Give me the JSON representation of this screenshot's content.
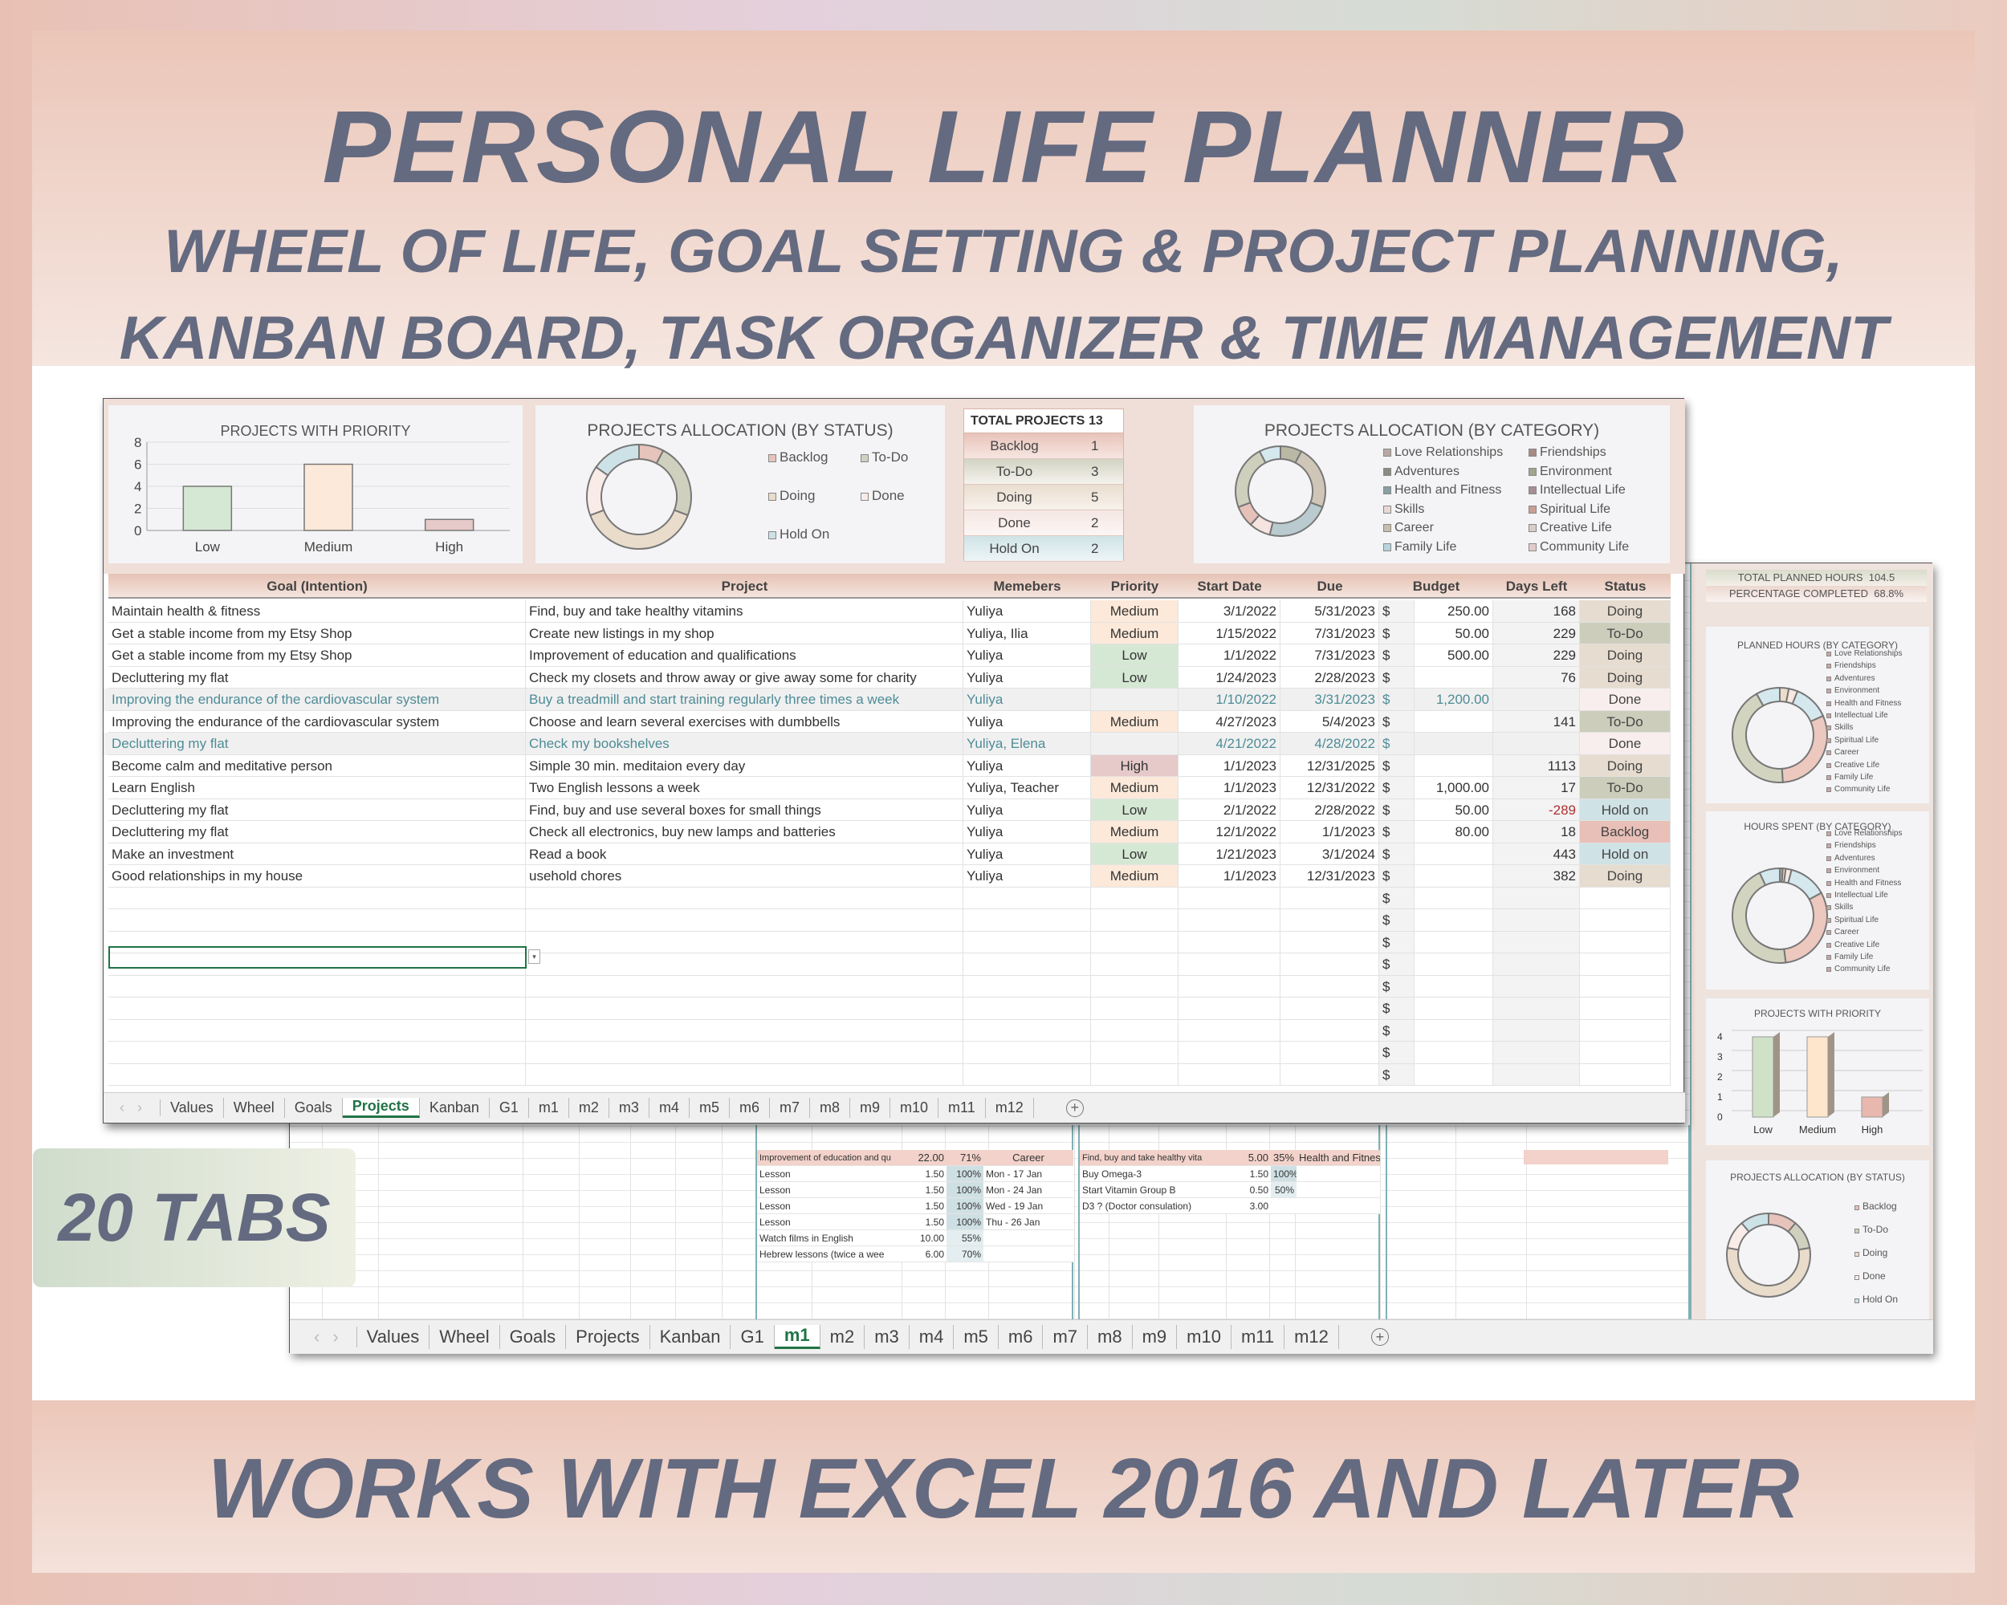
{
  "banner": {
    "title": "PERSONAL LIFE PLANNER",
    "subtitle1": "WHEEL OF LIFE, GOAL SETTING & PROJECT PLANNING,",
    "subtitle2": "KANBAN BOARD, TASK ORGANIZER & TIME MANAGEMENT",
    "footer": "WORKS WITH EXCEL 2016 AND LATER",
    "badge": "20 TABS"
  },
  "colors": {
    "text": "#646a80",
    "accent": "#217346",
    "Backlog": "#e8c0b8",
    "To-Do": "#cccdbb",
    "Doing": "#e6dccf",
    "Done": "#f9eeee",
    "Hold on": "#cfe2e6",
    "Low": "#d5e8d4",
    "Medium": "#fde9d9",
    "High": "#e6c9c9",
    "done_text": "#4e8c97",
    "negative": "#b03030"
  },
  "dashboard": {
    "priority_chart": {
      "title": "PROJECTS WITH PRIORITY",
      "type": "bar",
      "categories": [
        "Low",
        "Medium",
        "High"
      ],
      "values": [
        4,
        6,
        1
      ],
      "yticks": [
        "0",
        "2",
        "4",
        "6",
        "8"
      ],
      "ylim": [
        0,
        8
      ],
      "grid": true
    },
    "status_chart": {
      "title": "PROJECTS ALLOCATION (BY STATUS)",
      "type": "donut",
      "labels": [
        "Backlog",
        "To-Do",
        "Doing",
        "Done",
        "Hold On"
      ],
      "values": [
        1,
        3,
        5,
        2,
        2
      ],
      "colors": [
        "#e6c3bb",
        "#cfd0be",
        "#e9dccb",
        "#f9ece8",
        "#cde2e6"
      ]
    },
    "totals": {
      "label": "TOTAL PROJECTS",
      "value": "13",
      "rows": [
        {
          "label": "Backlog",
          "value": "1"
        },
        {
          "label": "To-Do",
          "value": "3"
        },
        {
          "label": "Doing",
          "value": "5"
        },
        {
          "label": "Done",
          "value": "2"
        },
        {
          "label": "Hold On",
          "value": "2"
        }
      ]
    },
    "category_chart": {
      "title": "PROJECTS ALLOCATION (BY CATEGORY)",
      "type": "donut",
      "legend": [
        "Love Relationships",
        "Friendships",
        "Adventures",
        "Environment",
        "Health and Fitness",
        "Intellectual Life",
        "Skills",
        "Spiritual Life",
        "Career",
        "Creative Life",
        "Family Life",
        "Community Life"
      ],
      "segments": [
        {
          "label": "Environment",
          "value": 1,
          "color": "#b8b8a4"
        },
        {
          "label": "Love Relationships",
          "value": 3,
          "color": "#cfc6b8"
        },
        {
          "label": "Health and Fitness",
          "value": 3,
          "color": "#b9cbce"
        },
        {
          "label": "Skills",
          "value": 1,
          "color": "#f6e4e0"
        },
        {
          "label": "Spiritual Life",
          "value": 1,
          "color": "#e6c1b8"
        },
        {
          "label": "Career",
          "value": 3,
          "color": "#cfcfbd"
        },
        {
          "label": "Family Life",
          "value": 1,
          "color": "#d4e8ee"
        }
      ]
    }
  },
  "table": {
    "headers": [
      "Goal (Intention)",
      "Project",
      "Memebers",
      "Priority",
      "Start Date",
      "Due",
      "Budget",
      "Days Left",
      "Status"
    ],
    "currency": "$",
    "rows": [
      {
        "goal": "Maintain health & fitness",
        "project": "Find, buy and take healthy vitamins",
        "members": "Yuliya",
        "priority": "Medium",
        "start": "3/1/2022",
        "due": "5/31/2023",
        "budget": "250.00",
        "days": "168",
        "status": "Doing"
      },
      {
        "goal": "Get a stable income from my Etsy Shop",
        "project": "Create new listings in my shop",
        "members": "Yuliya, Ilia",
        "priority": "Medium",
        "start": "1/15/2022",
        "due": "7/31/2023",
        "budget": "50.00",
        "days": "229",
        "status": "To-Do"
      },
      {
        "goal": "Get a stable income from my Etsy Shop",
        "project": "Improvement of education and qualifications",
        "members": "Yuliya",
        "priority": "Low",
        "start": "1/1/2022",
        "due": "7/31/2023",
        "budget": "500.00",
        "days": "229",
        "status": "Doing"
      },
      {
        "goal": "Decluttering my flat",
        "project": "Check my closets and throw away or give away some for charity",
        "members": "Yuliya",
        "priority": "Low",
        "start": "1/24/2023",
        "due": "2/28/2023",
        "budget": "",
        "days": "76",
        "status": "Doing"
      },
      {
        "goal": "Improving the endurance of the cardiovascular system",
        "project": "Buy a treadmill and start training regularly three times a week",
        "members": "Yuliya",
        "priority": "",
        "start": "1/10/2022",
        "due": "3/31/2023",
        "budget": "1,200.00",
        "days": "",
        "status": "Done"
      },
      {
        "goal": "Improving the endurance of the cardiovascular system",
        "project": "Choose and learn several exercises with dumbbells",
        "members": "Yuliya",
        "priority": "Medium",
        "start": "4/27/2023",
        "due": "5/4/2023",
        "budget": "",
        "days": "141",
        "status": "To-Do"
      },
      {
        "goal": "Decluttering my flat",
        "project": "Check my bookshelves",
        "members": "Yuliya, Elena",
        "priority": "",
        "start": "4/21/2022",
        "due": "4/28/2022",
        "budget": "",
        "days": "",
        "status": "Done"
      },
      {
        "goal": "Become calm and meditative person",
        "project": "Simple 30 min. meditaion every day",
        "members": "Yuliya",
        "priority": "High",
        "start": "1/1/2023",
        "due": "12/31/2025",
        "budget": "",
        "days": "1113",
        "status": "Doing"
      },
      {
        "goal": "Learn English",
        "project": "Two English lessons a week",
        "members": "Yuliya, Teacher",
        "priority": "Medium",
        "start": "1/1/2023",
        "due": "12/31/2022",
        "budget": "1,000.00",
        "days": "17",
        "status": "To-Do"
      },
      {
        "goal": "Decluttering my flat",
        "project": "Find, buy and use several boxes for small things",
        "members": "Yuliya",
        "priority": "Low",
        "start": "2/1/2022",
        "due": "2/28/2022",
        "budget": "50.00",
        "days": "-289",
        "status": "Hold on"
      },
      {
        "goal": "Decluttering my flat",
        "project": "Check all electronics, buy new lamps and batteries",
        "members": "Yuliya",
        "priority": "Medium",
        "start": "12/1/2022",
        "due": "1/1/2023",
        "budget": "80.00",
        "days": "18",
        "status": "Backlog"
      },
      {
        "goal": "Make an investment",
        "project": "Read a book",
        "members": "Yuliya",
        "priority": "Low",
        "start": "1/21/2023",
        "due": "3/1/2024",
        "budget": "",
        "days": "443",
        "status": "Hold on"
      },
      {
        "goal": "Good relationships in my house",
        "project": "usehold chores",
        "members": "Yuliya",
        "priority": "Medium",
        "start": "1/1/2023",
        "due": "12/31/2023",
        "budget": "",
        "days": "382",
        "status": "Doing"
      }
    ]
  },
  "sheet_tabs": [
    "Values",
    "Wheel",
    "Goals",
    "Projects",
    "Kanban",
    "G1",
    "m1",
    "m2",
    "m3",
    "m4",
    "m5",
    "m6",
    "m7",
    "m8",
    "m9",
    "m10",
    "m11",
    "m12"
  ],
  "front_active_tab": "Projects",
  "back_active_tab": "m1",
  "back": {
    "total_hours_label": "TOTAL PLANNED HOURS",
    "total_hours": "104.5",
    "pct_label": "PERCENTAGE COMPLETED",
    "pct": "68.8%",
    "categories": [
      "Love Relationships",
      "Friendships",
      "Adventures",
      "Environment",
      "Health and Fitness",
      "Intellectual Life",
      "Skills",
      "Spiritual Life",
      "Career",
      "Creative Life",
      "Family Life",
      "Community Life"
    ],
    "planned_chart": {
      "title": "PLANNED HOURS (BY CATEGORY)",
      "type": "donut",
      "values": [
        3,
        3,
        12,
        30,
        42,
        8
      ],
      "colors": [
        "#ecdccb",
        "#f8e8e2",
        "#d4e8ee",
        "#ecc8be",
        "#d2d4c0",
        "#d4e8ee"
      ]
    },
    "spent_chart": {
      "title": "HOURS SPENT (BY CATEGORY)",
      "type": "donut",
      "values": [
        1,
        1,
        2,
        13,
        31,
        45,
        7
      ],
      "colors": [
        "#aaa",
        "#ecdccb",
        "#f8e8e2",
        "#d4e8ee",
        "#ecc8be",
        "#d2d4c0",
        "#d4e8ee"
      ]
    },
    "priority_chart": {
      "title": "PROJECTS WITH PRIORITY",
      "type": "bar3d",
      "categories": [
        "Low",
        "Medium",
        "High"
      ],
      "values": [
        4,
        4,
        1
      ],
      "yticks": [
        "0",
        "1",
        "2",
        "3",
        "4"
      ],
      "ylim": [
        0,
        4
      ],
      "colors": [
        "#cfe2c8",
        "#fde6cc",
        "#e8b8ae"
      ]
    },
    "status_chart": {
      "title": "PROJECTS ALLOCATION (BY STATUS)",
      "type": "donut",
      "labels": [
        "Backlog",
        "To-Do",
        "Doing",
        "Done",
        "Hold On"
      ],
      "values": [
        1,
        1,
        5,
        1,
        1
      ],
      "colors": [
        "#e6c3bb",
        "#cfd0be",
        "#e9dccb",
        "#f9ece8",
        "#cde2e6"
      ]
    },
    "section1": {
      "header": [
        "Improvement of education and qu",
        "22.00",
        "71%",
        "Career"
      ],
      "rows": [
        [
          "Lesson",
          "1.50",
          "100%",
          "Mon - 17 Jan"
        ],
        [
          "Lesson",
          "1.50",
          "100%",
          "Mon - 24 Jan"
        ],
        [
          "Lesson",
          "1.50",
          "100%",
          "Wed - 19 Jan"
        ],
        [
          "Lesson",
          "1.50",
          "100%",
          "Thu - 26 Jan"
        ],
        [
          "Watch films in English",
          "10.00",
          "55%",
          ""
        ],
        [
          "Hebrew lessons (twice a wee",
          "6.00",
          "70%",
          ""
        ]
      ]
    },
    "section2": {
      "header": [
        "Find, buy and take healthy vita",
        "5.00",
        "35%",
        "Health and Fitness"
      ],
      "rows": [
        [
          "Buy Omega-3",
          "1.50",
          "100%",
          ""
        ],
        [
          "Start Vitamin Group B",
          "0.50",
          "50%",
          ""
        ],
        [
          "D3 ? (Doctor consulation)",
          "3.00",
          "",
          ""
        ]
      ]
    }
  }
}
